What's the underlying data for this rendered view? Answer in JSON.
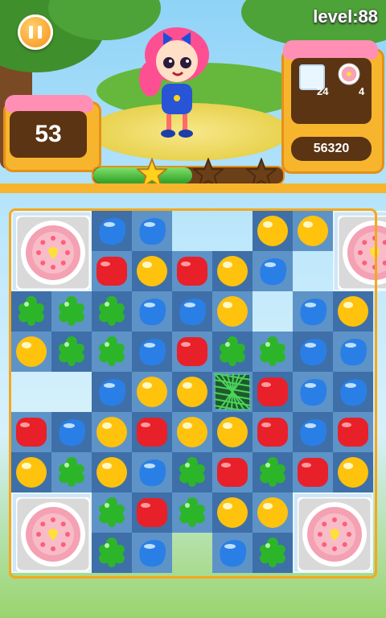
{
  "hud": {
    "level_text": "level:88",
    "moves": "53",
    "score": "56320",
    "goal_ice_count": "24",
    "goal_cake_count": "4",
    "progress_fraction": 0.52,
    "stars_earned": 1,
    "stars_total": 3
  },
  "colors": {
    "red": "#e8202a",
    "blue": "#2a7fe6",
    "green": "#2db52a",
    "yellow": "#ffc20d",
    "panel": "#f7b52d"
  },
  "board": {
    "rows": [
      [
        "C",
        "B",
        "B",
        ".",
        "Y",
        "Y",
        "C"
      ],
      [
        "C",
        "R",
        "Y",
        "R",
        "Y",
        "B",
        "C"
      ],
      [
        "G",
        "G",
        "G",
        "B",
        "B",
        "Y",
        "B",
        "Y"
      ],
      [
        "Y",
        "G",
        "G",
        "B",
        "R",
        "G",
        "G",
        "B",
        "B"
      ],
      [
        "",
        "B",
        "Y",
        "Y",
        "N",
        "R",
        "B",
        "B"
      ],
      [
        "R",
        "B",
        "Y",
        "R",
        "Y",
        "Y",
        "R",
        "B",
        "R"
      ],
      [
        "Y",
        "G",
        "Y",
        "B",
        "G",
        "R",
        "G",
        "R",
        "Y"
      ],
      [
        "C",
        "G",
        "R",
        "G",
        "Y",
        "Y",
        "C"
      ],
      [
        "C",
        "G",
        "B",
        "",
        "B",
        "G",
        "C"
      ]
    ]
  }
}
